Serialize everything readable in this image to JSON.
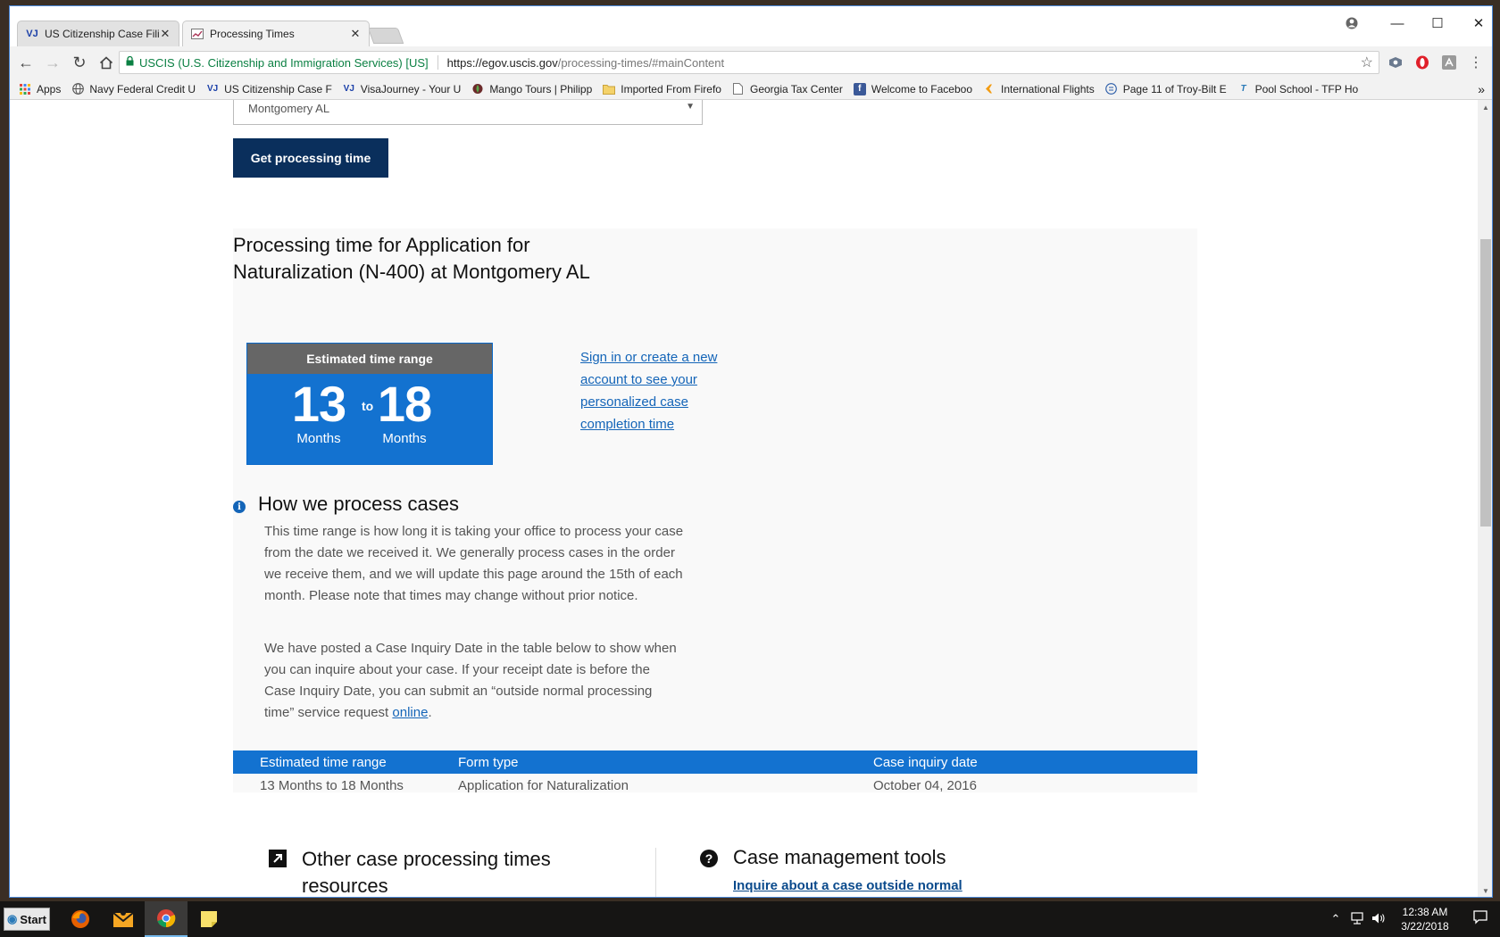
{
  "tabs": [
    {
      "title": "US Citizenship Case Filing",
      "favicon": "VJ"
    },
    {
      "title": "Processing Times",
      "favicon": "chart-icon"
    }
  ],
  "window_controls": {
    "profile": "profile-icon",
    "minimize": "—",
    "maximize": "☐",
    "close": "✕"
  },
  "address_bar": {
    "ev_label": "USCIS (U.S. Citizenship and Immigration Services) [US]",
    "url_scheme_host": "https://egov.uscis.gov",
    "url_path": "/processing-times/#mainContent"
  },
  "bookmarks": [
    {
      "label": "Apps",
      "icon": "apps-grid-icon"
    },
    {
      "label": "Navy Federal Credit U",
      "icon": "globe-icon"
    },
    {
      "label": "US Citizenship Case F",
      "icon": "VJ"
    },
    {
      "label": "VisaJourney - Your U",
      "icon": "VJ"
    },
    {
      "label": "Mango Tours | Philipp",
      "icon": "leaf-icon"
    },
    {
      "label": "Imported From Firefo",
      "icon": "folder-icon"
    },
    {
      "label": "Georgia Tax Center",
      "icon": "page-icon"
    },
    {
      "label": "Welcome to Faceboo",
      "icon": "facebook-icon"
    },
    {
      "label": "International Flights",
      "icon": "flight-icon"
    },
    {
      "label": "Page 11 of Troy-Bilt E",
      "icon": "doc-icon"
    },
    {
      "label": "Pool School - TFP Ho",
      "icon": "t-icon"
    }
  ],
  "bookmarks_overflow": "»",
  "page": {
    "office_select_value": "Montgomery AL",
    "get_button_label": "Get processing time",
    "result_title": "Processing time for Application for Naturalization (N-400) at Montgomery AL",
    "time_box": {
      "header": "Estimated time range",
      "from_value": "13",
      "from_unit": "Months",
      "to_label": "to",
      "to_value": "18",
      "to_unit": "Months"
    },
    "sign_in_link": "Sign in or create a new account to see your personalized case completion time",
    "how_title": "How we process cases",
    "how_para1": "This time range is how long it is taking your office to process your case from the date we received it. We generally process cases in the order we receive them, and we will update this page around the 15th of each month. Please note that times may change without prior notice.",
    "how_para2_text": "We have posted a Case Inquiry Date in the table below to show when you can inquire about your case. If your receipt date is before the Case Inquiry Date, you can submit an “outside normal processing time” service request ",
    "how_para2_link": "online",
    "how_para2_end": ".",
    "table": {
      "headers": [
        "Estimated time range",
        "Form type",
        "Case inquiry date"
      ],
      "rows": [
        [
          "13 Months to 18 Months",
          "Application for Naturalization",
          "October 04, 2016"
        ]
      ]
    },
    "other_resources_title": "Other case processing times resources",
    "tools_title": "Case management tools",
    "tools_link": "Inquire about a case outside normal"
  },
  "taskbar": {
    "start_label": "Start",
    "apps": [
      "firefox-icon",
      "email-client-icon",
      "chrome-icon",
      "sticky-notes-icon"
    ],
    "clock_time": "12:38 AM",
    "clock_date": "3/22/2018"
  },
  "colors": {
    "primary_blue": "#1372d0",
    "dark_navy": "#0a2f5c",
    "link_blue": "#1465b8",
    "secure_green": "#0b8043"
  }
}
